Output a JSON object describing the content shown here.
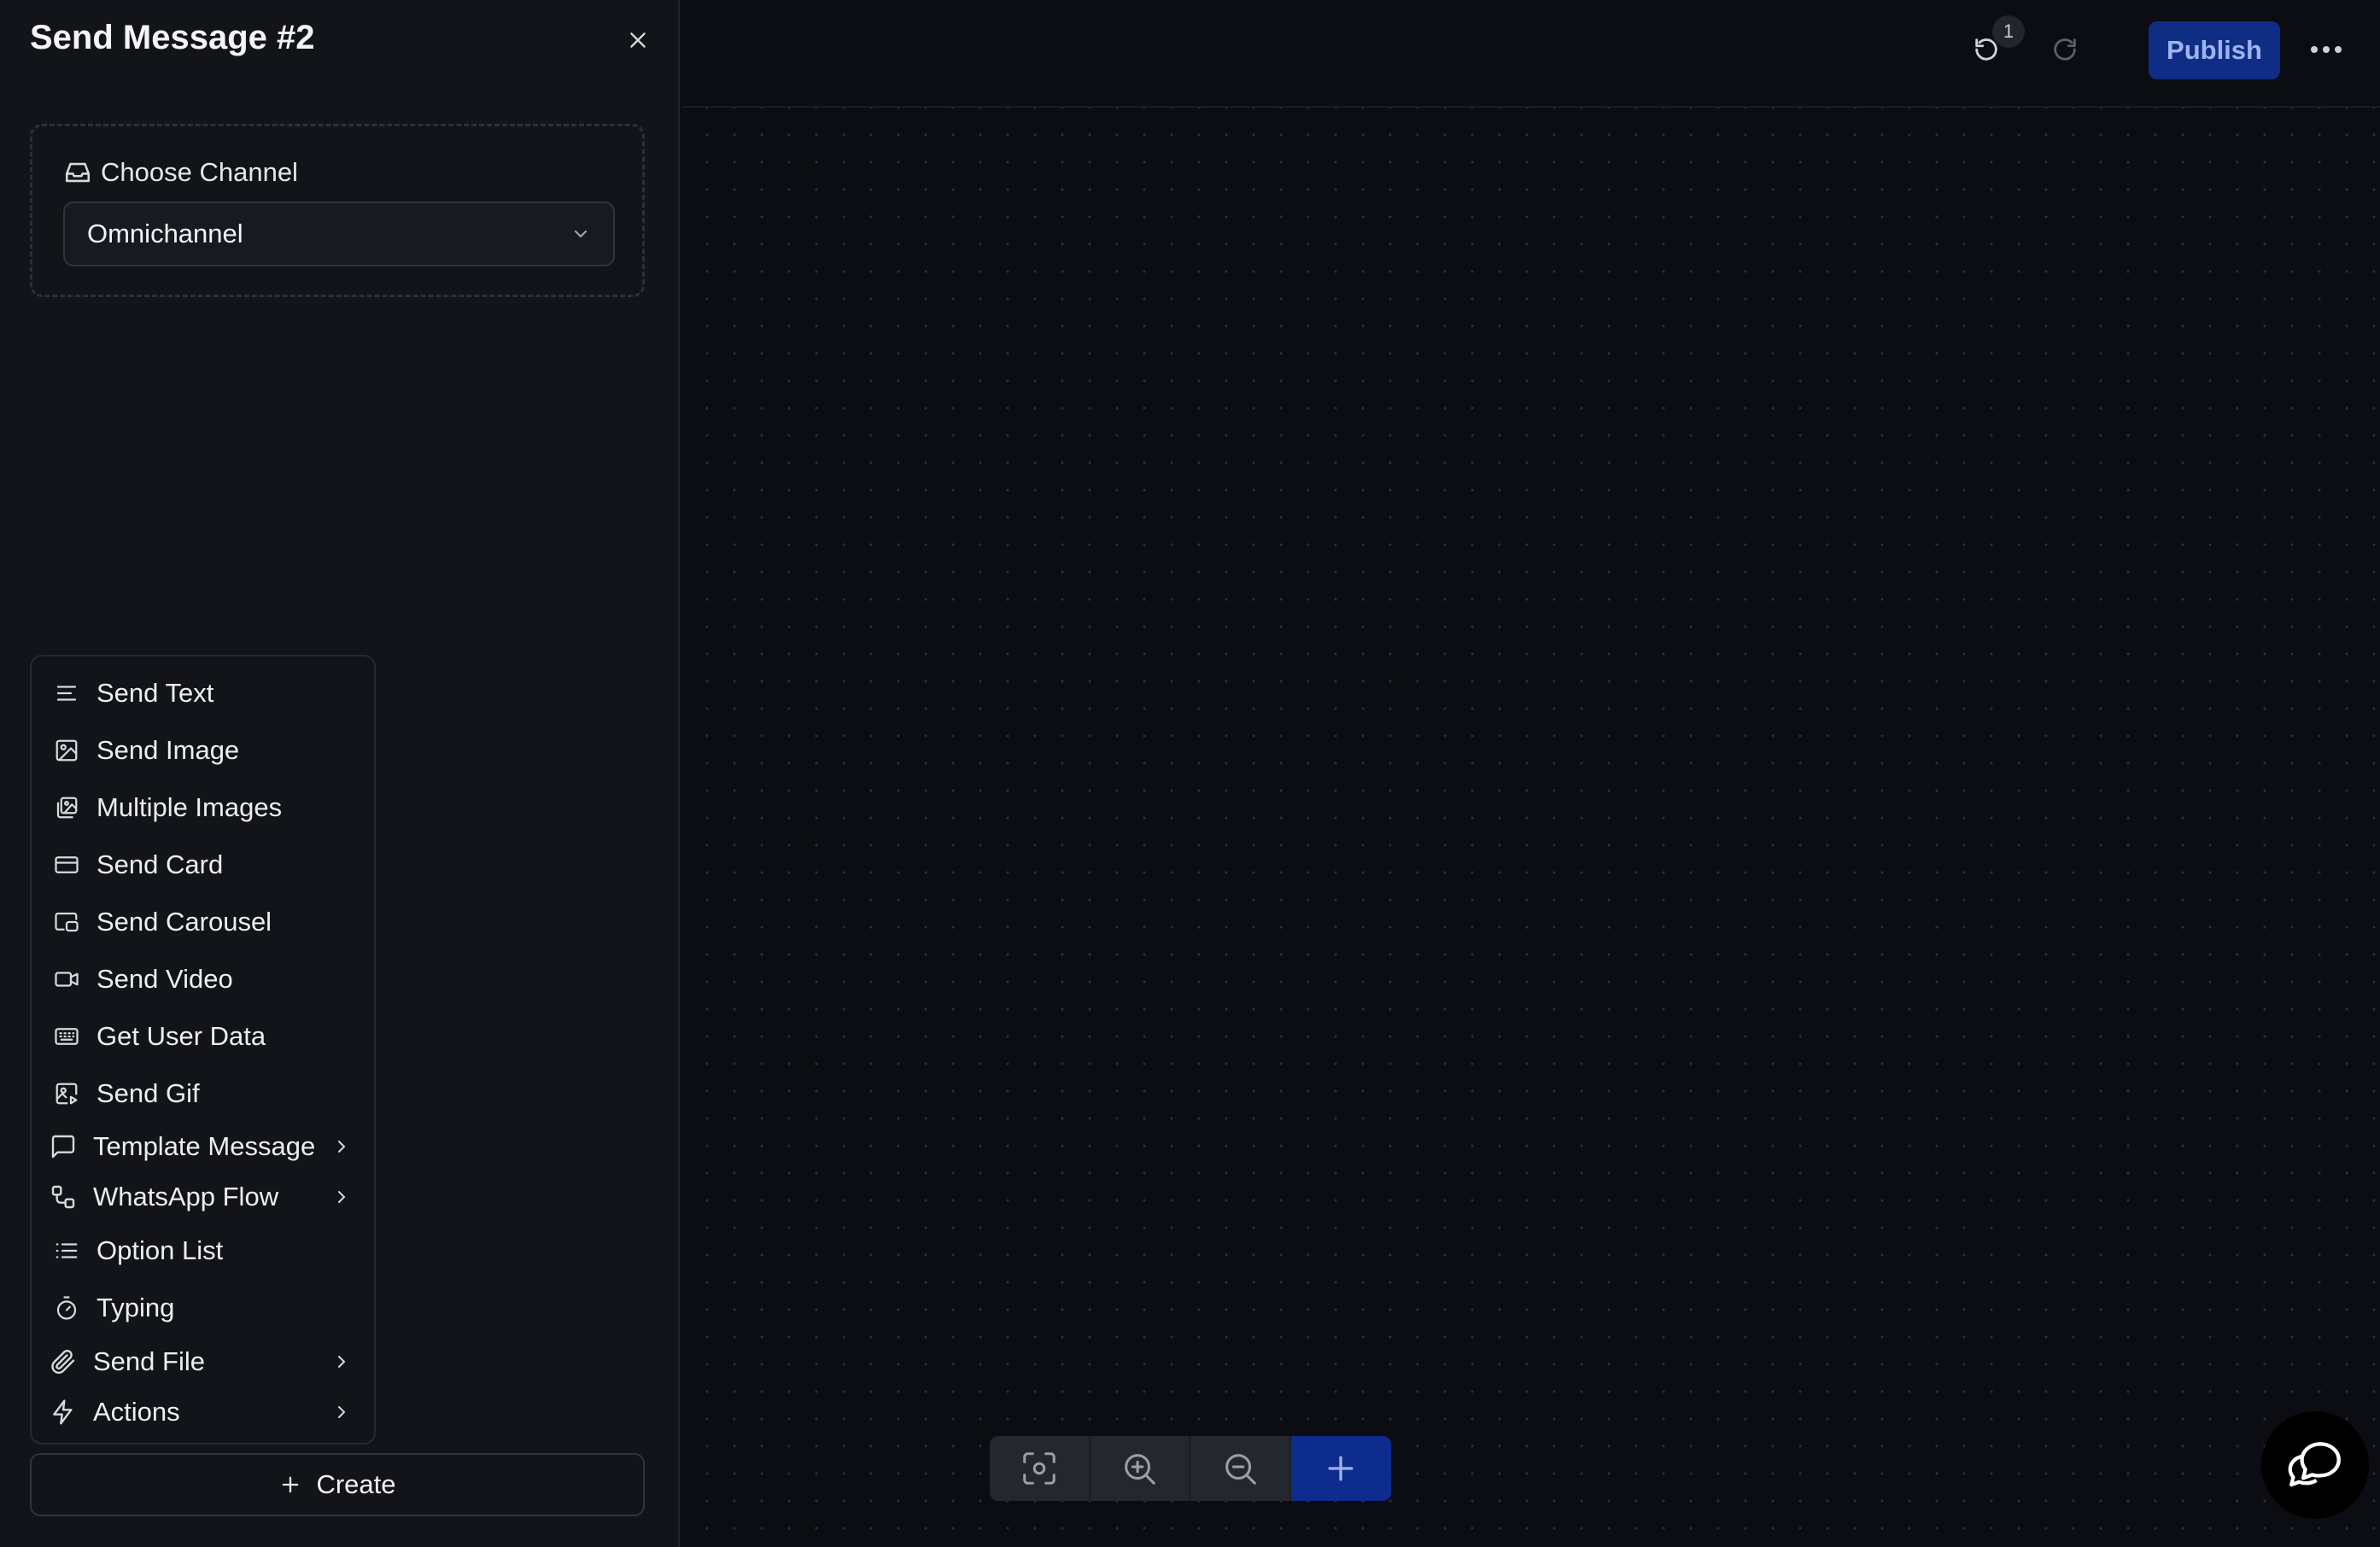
{
  "panel": {
    "title": "Send Message #2",
    "close_icon": "x-icon",
    "channel": {
      "label": "Choose Channel",
      "icon": "inbox-icon",
      "selected": "Omnichannel"
    },
    "menu_items": [
      {
        "label": "Send Text",
        "icon": "text-lines-icon"
      },
      {
        "label": "Send Image",
        "icon": "image-icon"
      },
      {
        "label": "Multiple Images",
        "icon": "images-icon"
      },
      {
        "label": "Send Card",
        "icon": "card-icon"
      },
      {
        "label": "Send Carousel",
        "icon": "carousel-icon"
      },
      {
        "label": "Send Video",
        "icon": "video-icon"
      },
      {
        "label": "Get User Data",
        "icon": "keyboard-icon"
      },
      {
        "label": "Send Gif",
        "icon": "gif-icon"
      },
      {
        "label": "Template Message",
        "icon": "message-square-icon",
        "submenu": true
      },
      {
        "label": "WhatsApp Flow",
        "icon": "flow-icon",
        "submenu": true
      },
      {
        "label": "Option List",
        "icon": "list-icon"
      },
      {
        "label": "Typing",
        "icon": "timer-icon"
      },
      {
        "label": "Send File",
        "icon": "paperclip-icon",
        "submenu": true
      },
      {
        "label": "Actions",
        "icon": "zap-icon",
        "submenu": true
      }
    ],
    "create_label": "Create"
  },
  "topbar": {
    "undo_count": "1",
    "publish_label": "Publish"
  },
  "zoom_controls": [
    "focus-icon",
    "zoom-in-icon",
    "zoom-out-icon",
    "add-icon"
  ],
  "colors": {
    "panel_bg": "#121419",
    "canvas_bg": "#0b0d12",
    "accent": "#0f2d84"
  }
}
